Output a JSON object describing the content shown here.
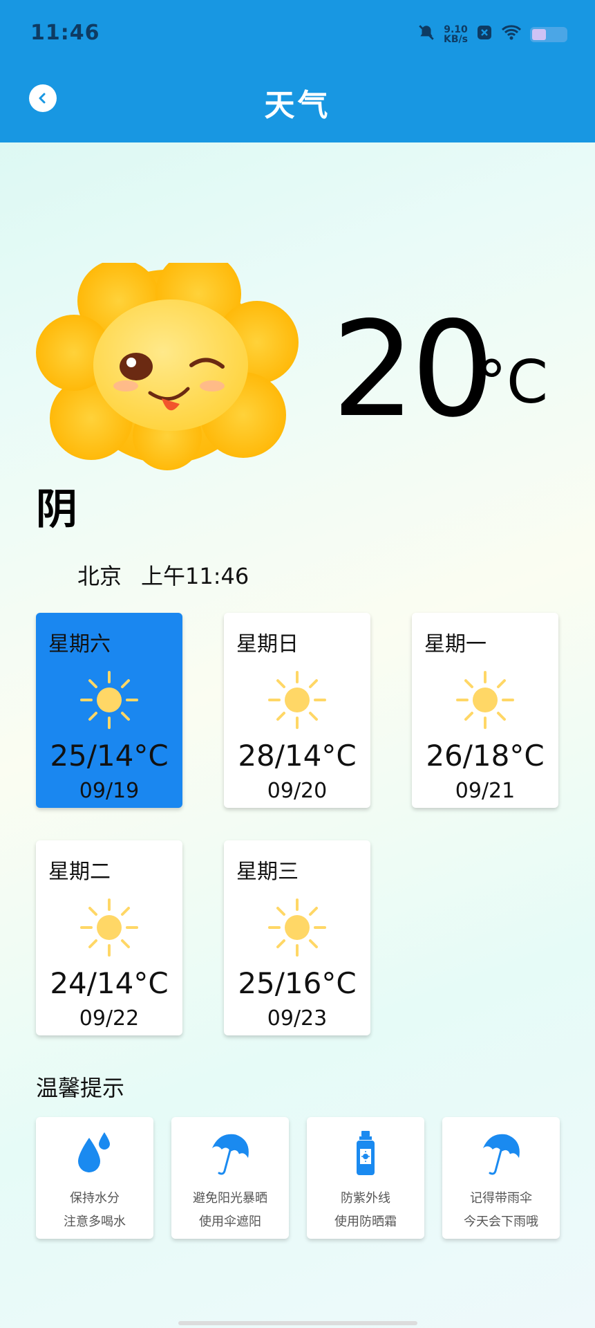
{
  "status_bar": {
    "time": "11:46",
    "net_speed_value": "9.10",
    "net_speed_unit": "KB/s",
    "icons": [
      "bell-mute-icon",
      "close-box-icon",
      "wifi-icon",
      "battery-icon"
    ]
  },
  "header": {
    "title": "天气",
    "back_icon": "chevron-left-icon",
    "background": "#1897e2"
  },
  "current": {
    "temperature": "20",
    "unit": "°C",
    "condition": "阴",
    "city": "北京",
    "updated_time": "上午11:46"
  },
  "forecast": [
    {
      "day": "星期六",
      "temp": "25/14°C",
      "date": "09/19",
      "icon": "sun-icon",
      "selected": true
    },
    {
      "day": "星期日",
      "temp": "28/14°C",
      "date": "09/20",
      "icon": "sun-icon",
      "selected": false
    },
    {
      "day": "星期一",
      "temp": "26/18°C",
      "date": "09/21",
      "icon": "sun-icon",
      "selected": false
    },
    {
      "day": "星期二",
      "temp": "24/14°C",
      "date": "09/22",
      "icon": "sun-icon",
      "selected": false
    },
    {
      "day": "星期三",
      "temp": "25/16°C",
      "date": "09/23",
      "icon": "sun-icon",
      "selected": false
    }
  ],
  "tips": {
    "title": "温馨提示",
    "items": [
      {
        "icon": "water-drops-icon",
        "line1": "保持水分",
        "line2": "注意多喝水"
      },
      {
        "icon": "umbrella-icon",
        "line1": "避免阳光暴晒",
        "line2": "使用伞遮阳"
      },
      {
        "icon": "sunscreen-bottle-icon",
        "line1": "防紫外线",
        "line2": "使用防晒霜"
      },
      {
        "icon": "umbrella-icon",
        "line1": "记得带雨伞",
        "line2": "今天会下雨哦"
      }
    ]
  },
  "colors": {
    "accent": "#1897e2",
    "selected_card": "#1a87f0",
    "sun_yellow": "#ffd766",
    "icon_blue": "#1a8af0"
  }
}
